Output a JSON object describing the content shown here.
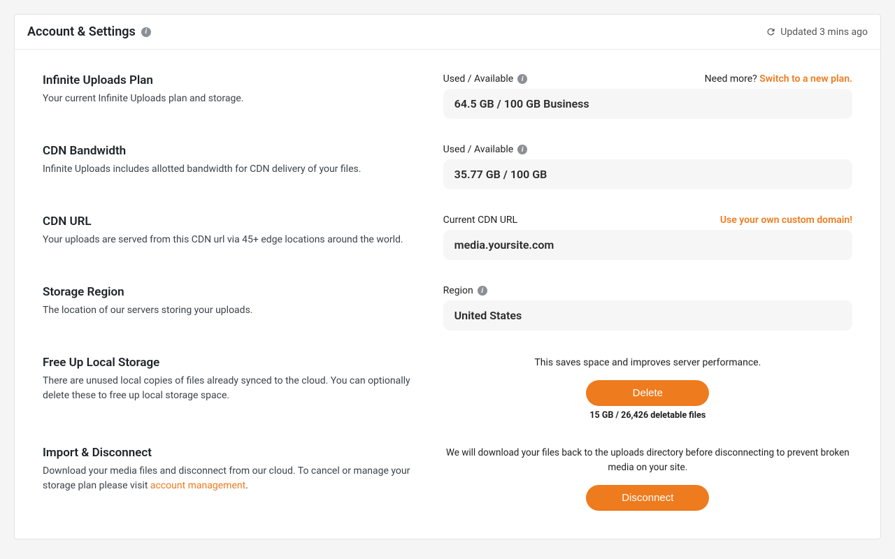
{
  "header": {
    "title": "Account & Settings",
    "updated_label": "Updated 3 mins ago"
  },
  "plan": {
    "title": "Infinite Uploads Plan",
    "desc": "Your current Infinite Uploads plan and storage.",
    "field_label": "Used / Available",
    "need_more": "Need more? ",
    "switch_link": "Switch to a new plan.",
    "value": "64.5 GB / 100 GB Business"
  },
  "bandwidth": {
    "title": "CDN Bandwidth",
    "desc": "Infinite Uploads includes allotted bandwidth for CDN delivery of your files.",
    "field_label": "Used / Available",
    "value": "35.77 GB / 100 GB"
  },
  "cdn_url": {
    "title": "CDN URL",
    "desc": "Your uploads are served from this CDN url via 45+ edge locations around the world.",
    "field_label": "Current CDN URL",
    "custom_link": "Use your own custom domain!",
    "value": "media.yoursite.com"
  },
  "region": {
    "title": "Storage Region",
    "desc": "The location of our servers storing your uploads.",
    "field_label": "Region",
    "value": "United States"
  },
  "free_up": {
    "title": "Free Up Local Storage",
    "desc": "There are unused local copies of files already synced to the cloud. You can optionally delete these to free up local storage space.",
    "note": "This saves space and improves server performance.",
    "button": "Delete",
    "deletable": "15 GB / 26,426 deletable files"
  },
  "disconnect": {
    "title": "Import & Disconnect",
    "desc_pre": "Download your media files and disconnect from our cloud. To cancel or manage your storage plan please visit ",
    "account_link": "account management",
    "desc_post": ".",
    "note": "We will download your files back to the uploads directory before disconnecting to prevent broken media on your site.",
    "button": "Disconnect"
  }
}
